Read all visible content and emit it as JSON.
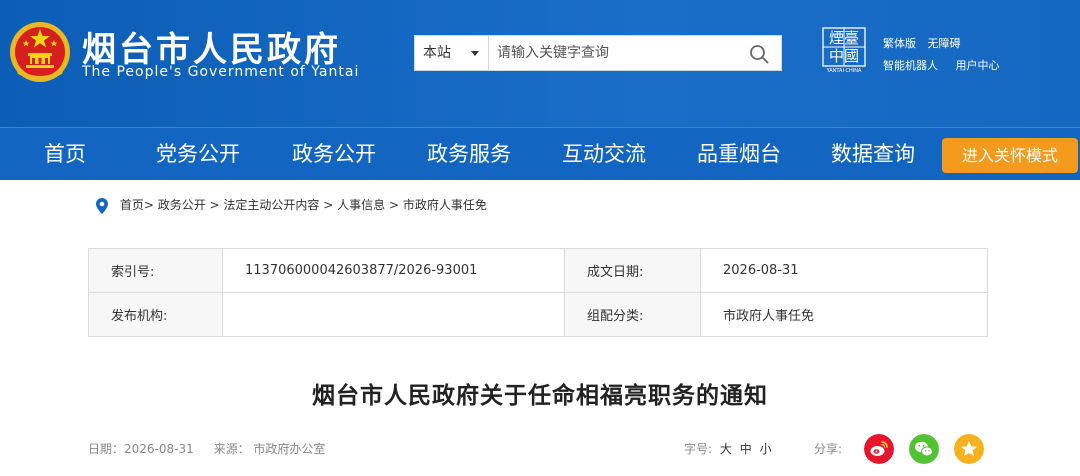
{
  "header": {
    "site_name": "烟台市人民政府",
    "site_name_en": "The People's Government of Yantai",
    "china_logo_text": "煙臺中國",
    "china_logo_caption": "YANTAI·CHINA",
    "links_row1": [
      "繁体版",
      "无障碍"
    ],
    "links_row2": [
      "智能机器人",
      "用户中心"
    ]
  },
  "search": {
    "scope": "本站",
    "placeholder": "请输入关键字查询"
  },
  "nav": {
    "items": [
      "首页",
      "党务公开",
      "政务公开",
      "政务服务",
      "互动交流",
      "品重烟台",
      "数据查询"
    ],
    "care_mode": "进入关怀模式"
  },
  "breadcrumb": [
    "首页",
    "政务公开",
    "法定主动公开内容",
    "人事信息",
    "市政府人事任免"
  ],
  "info": {
    "index_label": "索引号:",
    "index_value": "113706000042603877/2026-93001",
    "date_label": "成文日期:",
    "date_value": "2026-08-31",
    "publisher_label": "发布机构:",
    "publisher_value": "",
    "category_label": "组配分类:",
    "category_value": "市政府人事任免"
  },
  "article": {
    "title": "烟台市人民政府关于任命相福亮职务的通知",
    "date": "日期：2026-08-31",
    "source": "来源：  市政府办公室",
    "font_label": "字号:",
    "font_sizes": [
      "大",
      "中",
      "小"
    ],
    "share_label": "分享:"
  },
  "colors": {
    "header_blue": "#1266c2",
    "care_orange": "#f49b1d",
    "weibo_red": "#e6162d",
    "wechat_green": "#51c332",
    "favorite_yellow": "#f5b21e"
  }
}
